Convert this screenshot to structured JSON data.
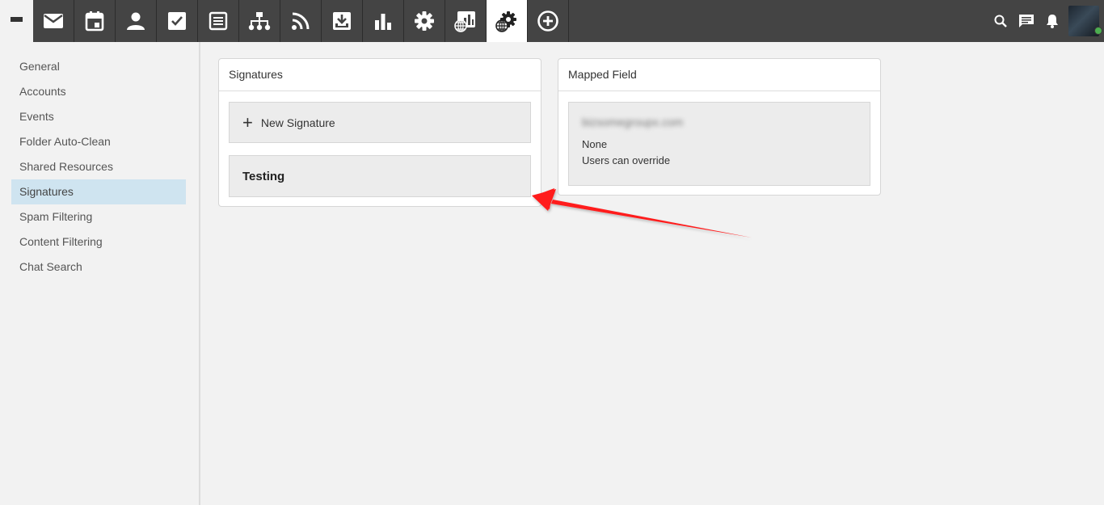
{
  "toolbar": {
    "tabs": [
      {
        "icon": "mail-icon",
        "active": false
      },
      {
        "icon": "calendar-icon",
        "active": false
      },
      {
        "icon": "contacts-icon",
        "active": false
      },
      {
        "icon": "tasks-icon",
        "active": false
      },
      {
        "icon": "notes-icon",
        "active": false
      },
      {
        "icon": "sitemap-icon",
        "active": false
      },
      {
        "icon": "rss-icon",
        "active": false
      },
      {
        "icon": "download-icon",
        "active": false
      },
      {
        "icon": "reports-icon",
        "active": false
      },
      {
        "icon": "settings-icon",
        "active": false
      },
      {
        "icon": "domain-reports-icon",
        "active": false
      },
      {
        "icon": "domain-settings-icon",
        "active": true
      },
      {
        "icon": "add-circle-icon",
        "active": false
      }
    ],
    "right_icons": [
      "search-icon",
      "chat-icon",
      "bell-icon"
    ],
    "status_color": "#4caf50"
  },
  "sidebar": {
    "items": [
      {
        "label": "General"
      },
      {
        "label": "Accounts"
      },
      {
        "label": "Events"
      },
      {
        "label": "Folder Auto-Clean"
      },
      {
        "label": "Shared Resources"
      },
      {
        "label": "Signatures",
        "selected": true
      },
      {
        "label": "Spam Filtering"
      },
      {
        "label": "Content Filtering"
      },
      {
        "label": "Chat Search"
      }
    ]
  },
  "signatures_card": {
    "title": "Signatures",
    "new_label": "New Signature",
    "items": [
      {
        "name": "Testing"
      }
    ]
  },
  "mapped_card": {
    "title": "Mapped Field",
    "blurred_value": "bizsomegroupx.com",
    "value": "None",
    "override": "Users can override"
  },
  "colors": {
    "topbar": "#444444",
    "selected": "#cfe4f0",
    "arrow": "#ff0000"
  }
}
